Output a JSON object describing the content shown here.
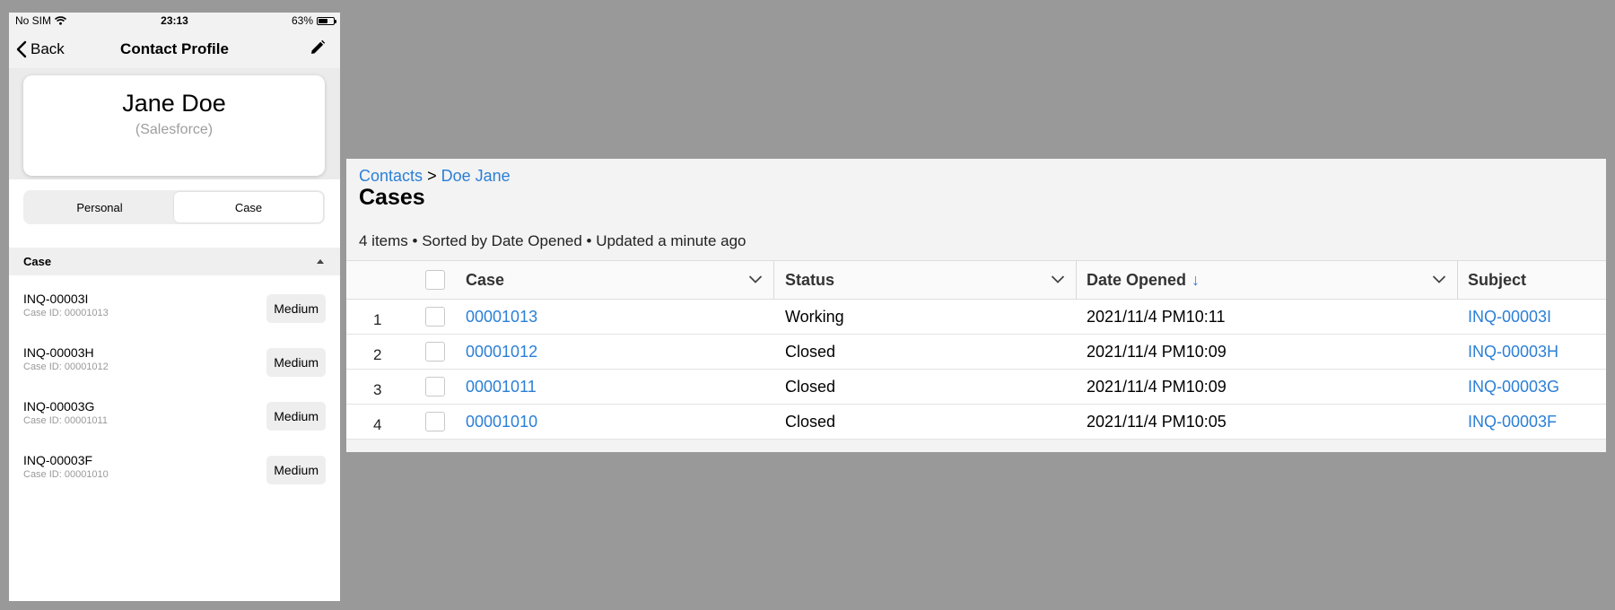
{
  "phone": {
    "status": {
      "carrier": "No SIM",
      "time": "23:13",
      "battery": "63%",
      "battery_level": 0.63
    },
    "nav": {
      "back_label": "Back",
      "title": "Contact Profile",
      "edit_icon": "pencil-icon"
    },
    "profile": {
      "name": "Jane Doe",
      "source": "(Salesforce)"
    },
    "tabs": [
      {
        "label": "Personal"
      },
      {
        "label": "Case"
      }
    ],
    "section": {
      "title": "Case"
    },
    "cases": [
      {
        "title": "INQ-00003I",
        "subtitle": "Case ID: 00001013",
        "priority": "Medium"
      },
      {
        "title": "INQ-00003H",
        "subtitle": "Case ID: 00001012",
        "priority": "Medium"
      },
      {
        "title": "INQ-00003G",
        "subtitle": "Case ID: 00001011",
        "priority": "Medium"
      },
      {
        "title": "INQ-00003F",
        "subtitle": "Case ID: 00001010",
        "priority": "Medium"
      }
    ]
  },
  "desktop": {
    "breadcrumb": {
      "parent": "Contacts",
      "separator": ">",
      "current": "Doe Jane"
    },
    "title": "Cases",
    "meta": "4 items • Sorted by Date Opened • Updated a minute ago",
    "columns": {
      "case": "Case",
      "status": "Status",
      "date_opened": "Date Opened",
      "subject": "Subject"
    },
    "sort_indicator": "↓",
    "rows": [
      {
        "num": "1",
        "case": "00001013",
        "status": "Working",
        "date": "2021/11/4 PM10:11",
        "subject": "INQ-00003I"
      },
      {
        "num": "2",
        "case": "00001012",
        "status": "Closed",
        "date": "2021/11/4 PM10:09",
        "subject": "INQ-00003H"
      },
      {
        "num": "3",
        "case": "00001011",
        "status": "Closed",
        "date": "2021/11/4 PM10:09",
        "subject": "INQ-00003G"
      },
      {
        "num": "4",
        "case": "00001010",
        "status": "Closed",
        "date": "2021/11/4 PM10:05",
        "subject": "INQ-00003F"
      }
    ]
  },
  "colors": {
    "link": "#2b7fd6",
    "backdrop": "#999999"
  }
}
